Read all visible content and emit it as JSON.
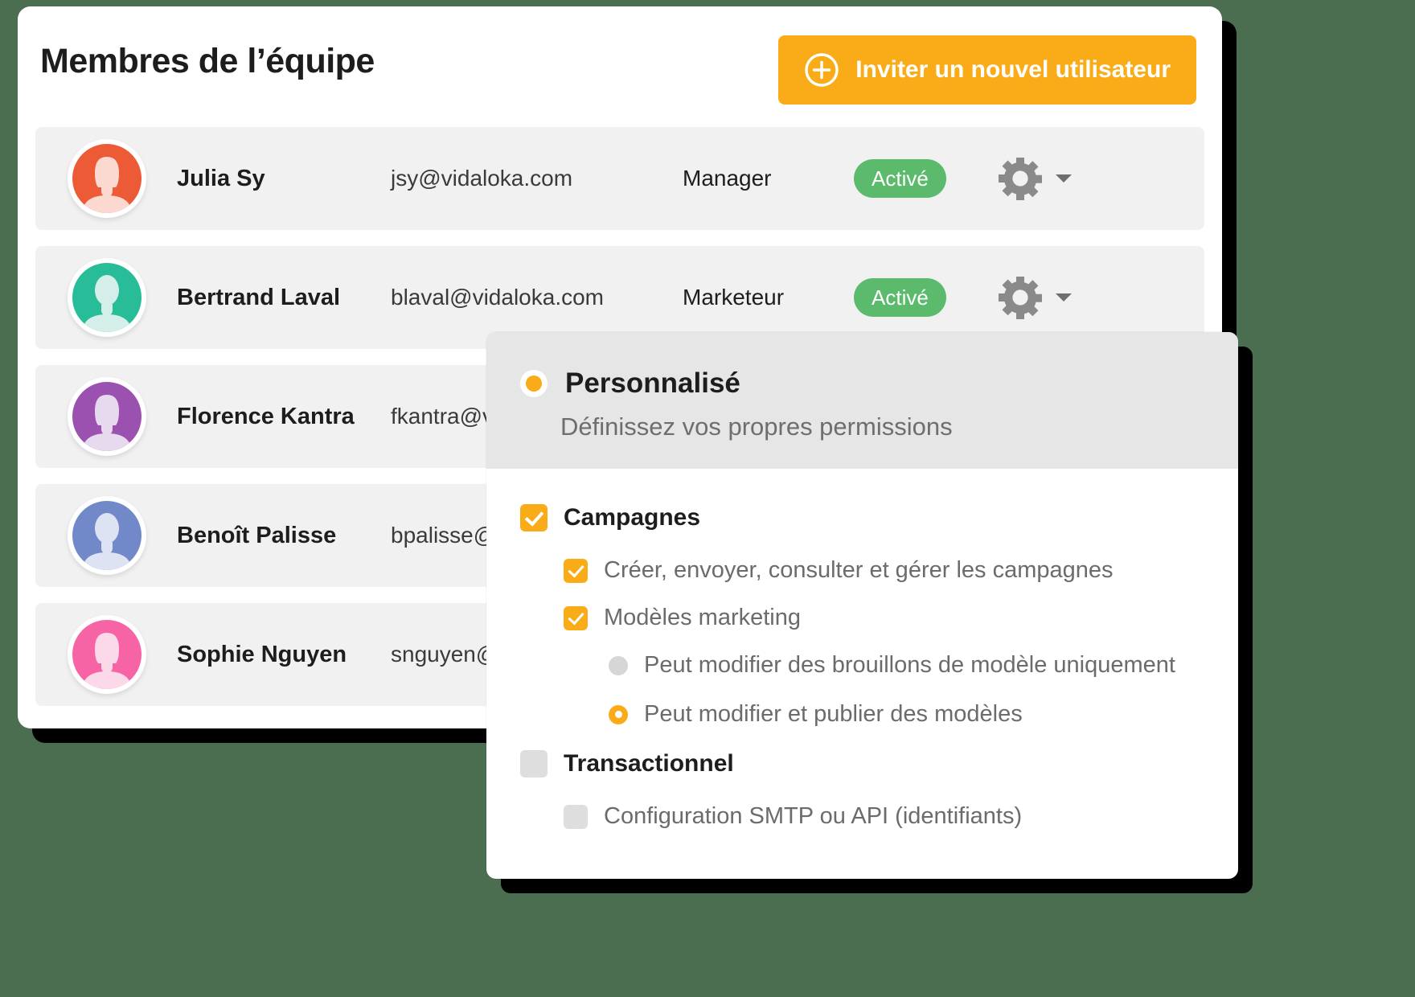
{
  "theme": {
    "background": "#4b6e50",
    "accent": "#faac18",
    "status_green": "#5cba6d",
    "card_bg": "#ffffff",
    "row_bg": "#f1f1f1"
  },
  "header": {
    "title": "Membres de l’équipe",
    "invite_label": "Inviter un nouvel utilisateur",
    "invite_icon": "plus-circle-icon"
  },
  "members": [
    {
      "name": "Julia Sy",
      "email": "jsy@vidaloka.com",
      "role": "Manager",
      "status": "Activé",
      "avatar_color": "#ec5a36",
      "avatar_fg": "#fbd9d0",
      "avatar_type": "female",
      "gear_icon": "gear-icon",
      "caret_icon": "caret-down-icon"
    },
    {
      "name": "Bertrand Laval",
      "email": "blaval@vidaloka.com",
      "role": "Marketeur",
      "status": "Activé",
      "avatar_color": "#28bd98",
      "avatar_fg": "#d4efe9",
      "avatar_type": "male",
      "gear_icon": "gear-icon",
      "caret_icon": "caret-down-icon"
    },
    {
      "name": "Florence Kantra",
      "email": "fkantra@vidaloka.com",
      "role": "",
      "status": "",
      "avatar_color": "#9b51b0",
      "avatar_fg": "#e7d9ee",
      "avatar_type": "female",
      "gear_icon": "gear-icon",
      "caret_icon": "caret-down-icon"
    },
    {
      "name": "Benoît Palisse",
      "email": "bpalisse@vidaloka.com",
      "role": "",
      "status": "",
      "avatar_color": "#7189c8",
      "avatar_fg": "#dde3f3",
      "avatar_type": "male",
      "gear_icon": "gear-icon",
      "caret_icon": "caret-down-icon"
    },
    {
      "name": "Sophie Nguyen",
      "email": "snguyen@vidaloka.com",
      "role": "",
      "status": "",
      "avatar_color": "#f664a6",
      "avatar_fg": "#fcd9e9",
      "avatar_type": "female",
      "gear_icon": "gear-icon",
      "caret_icon": "caret-down-icon"
    }
  ],
  "permissions_popup": {
    "radio_selected": true,
    "title": "Personnalisé",
    "subtitle": "Définissez vos propres permissions",
    "items": [
      {
        "level": 0,
        "control": "checkbox",
        "checked": true,
        "label": "Campagnes",
        "strong": true
      },
      {
        "level": 1,
        "control": "checkbox",
        "checked": true,
        "label": "Créer, envoyer, consulter et gérer les campagnes",
        "strong": false
      },
      {
        "level": 1,
        "control": "checkbox",
        "checked": true,
        "label": "Modèles marketing",
        "strong": false
      },
      {
        "level": 2,
        "control": "radio",
        "checked": false,
        "label": "Peut modifier des brouillons de modèle uniquement",
        "strong": false
      },
      {
        "level": 2,
        "control": "radio",
        "checked": true,
        "label": "Peut modifier et publier des modèles",
        "strong": false
      },
      {
        "level": 0,
        "control": "checkbox",
        "checked": false,
        "label": "Transactionnel",
        "strong": true
      },
      {
        "level": 1,
        "control": "checkbox",
        "checked": false,
        "label": "Configuration SMTP ou API (identifiants)",
        "strong": false
      }
    ]
  }
}
